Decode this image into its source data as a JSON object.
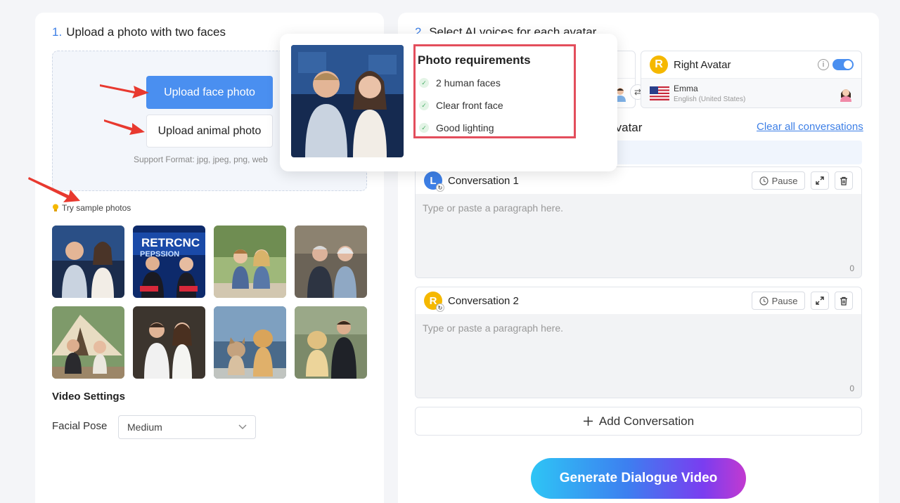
{
  "left": {
    "step_num": "1.",
    "step_title": "Upload a photo with two faces",
    "upload_face_label": "Upload face photo",
    "upload_animal_label": "Upload animal photo",
    "support_format": "Support Format: jpg, jpeg, png, web",
    "try_sample": "Try sample photos",
    "samples": [
      {
        "name": "sample-couple-newsroom"
      },
      {
        "name": "sample-news-anchors"
      },
      {
        "name": "sample-kids-park"
      },
      {
        "name": "sample-elderly-couple"
      },
      {
        "name": "sample-camping-couple"
      },
      {
        "name": "sample-studio-couple"
      },
      {
        "name": "sample-cat-dog"
      },
      {
        "name": "sample-dog-man"
      }
    ],
    "news_banner_text": "RETRCNC",
    "news_banner_sub": "PEPSSION",
    "video_settings": "Video Settings",
    "facial_pose_label": "Facial Pose",
    "facial_pose_value": "Medium"
  },
  "popover": {
    "title": "Photo requirements",
    "items": [
      "2 human faces",
      "Clear front face",
      "Good lighting"
    ]
  },
  "right": {
    "step_num": "2.",
    "step_title": "Select AI voices for each avatar",
    "right_avatar_letter": "R",
    "right_avatar_label": "Right Avatar",
    "voice_name": "Emma",
    "voice_locale": "English (United States)",
    "section_tail": "n avatar",
    "clear_all": "Clear all conversations",
    "conversations": [
      {
        "letter": "L",
        "title": "Conversation 1",
        "pause": "Pause",
        "placeholder": "Type or paste a paragraph here.",
        "count": "0"
      },
      {
        "letter": "R",
        "title": "Conversation 2",
        "pause": "Pause",
        "placeholder": "Type or paste a paragraph here.",
        "count": "0"
      }
    ],
    "add_conversation": "Add Conversation",
    "generate": "Generate Dialogue Video"
  },
  "colors": {
    "accent": "#4a8ff0",
    "left_avatar": "#3d7fe6",
    "right_avatar": "#f5b800",
    "highlight_border": "#e34e5c"
  }
}
